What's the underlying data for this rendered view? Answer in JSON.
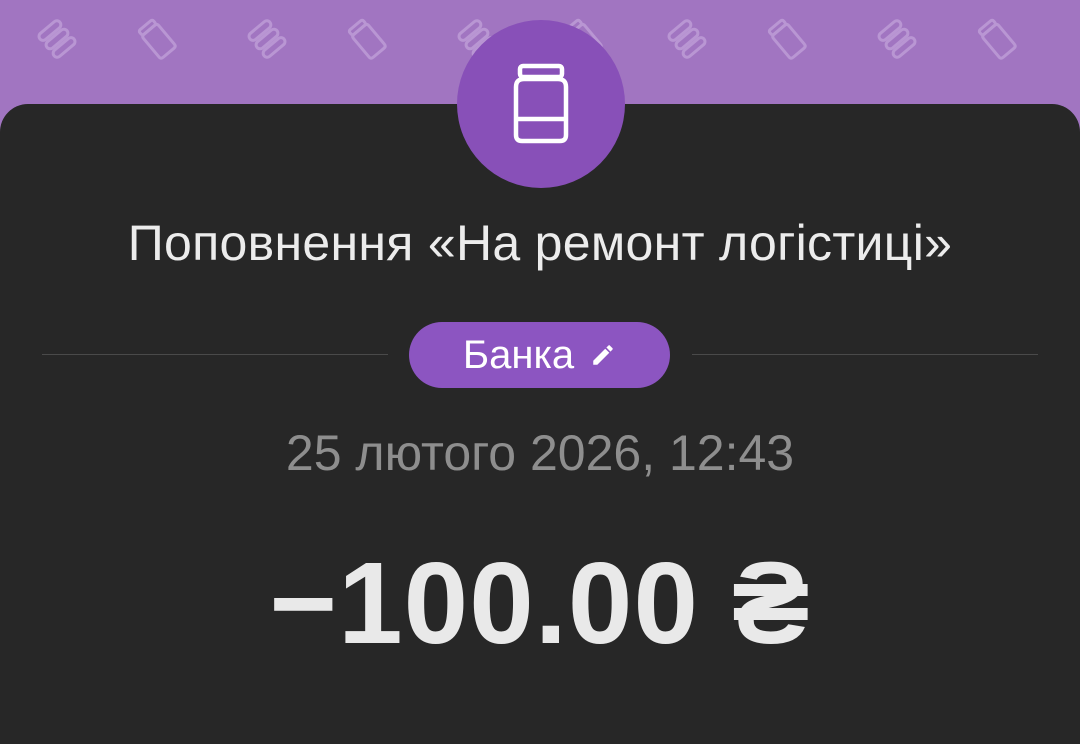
{
  "header": {
    "background_color": "#a175c1",
    "pattern_icons": [
      "coins-icon",
      "jar-icon",
      "coins-icon",
      "jar-icon",
      "coins-icon",
      "jar-icon",
      "coins-icon",
      "jar-icon",
      "coins-icon",
      "jar-icon"
    ]
  },
  "avatar": {
    "icon": "jar-icon",
    "color": "#8850b8"
  },
  "transaction": {
    "title": "Поповнення «На ремонт логістиці»",
    "category_chip": {
      "label": "Банка",
      "icon": "pencil-icon",
      "color": "#8c55c1"
    },
    "datetime": "25 лютого 2026, 12:43",
    "amount": "−100.00 ₴"
  },
  "card": {
    "background_color": "#272727"
  }
}
